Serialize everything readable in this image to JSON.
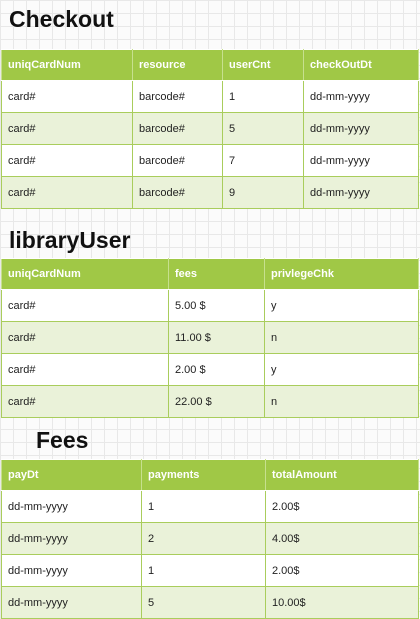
{
  "checkout": {
    "title": "Checkout",
    "headers": [
      "uniqCardNum",
      "resource",
      "userCnt",
      "checkOutDt"
    ],
    "rows": [
      [
        "card#",
        "barcode#",
        "1",
        "dd-mm-yyyy"
      ],
      [
        "card#",
        "barcode#",
        "5",
        "dd-mm-yyyy"
      ],
      [
        "card#",
        "barcode#",
        "7",
        "dd-mm-yyyy"
      ],
      [
        "card#",
        "barcode#",
        "9",
        "dd-mm-yyyy"
      ]
    ]
  },
  "library_user": {
    "title": "libraryUser",
    "headers": [
      "uniqCardNum",
      "fees",
      "privlegeChk"
    ],
    "rows": [
      [
        "card#",
        "5.00 $",
        "y"
      ],
      [
        "card#",
        "11.00 $",
        "n"
      ],
      [
        "card#",
        "2.00 $",
        "y"
      ],
      [
        "card#",
        "22.00 $",
        "n"
      ]
    ]
  },
  "fees": {
    "title": "Fees",
    "headers": [
      "payDt",
      "payments",
      "totalAmount"
    ],
    "rows": [
      [
        "dd-mm-yyyy",
        "1",
        "2.00$"
      ],
      [
        "dd-mm-yyyy",
        "2",
        "4.00$"
      ],
      [
        "dd-mm-yyyy",
        "1",
        "2.00$"
      ],
      [
        "dd-mm-yyyy",
        "5",
        "10.00$"
      ]
    ]
  },
  "colors": {
    "header_bg": "#a0c846",
    "stripe_bg": "#eaf2d9",
    "border": "#a9cd5c"
  }
}
